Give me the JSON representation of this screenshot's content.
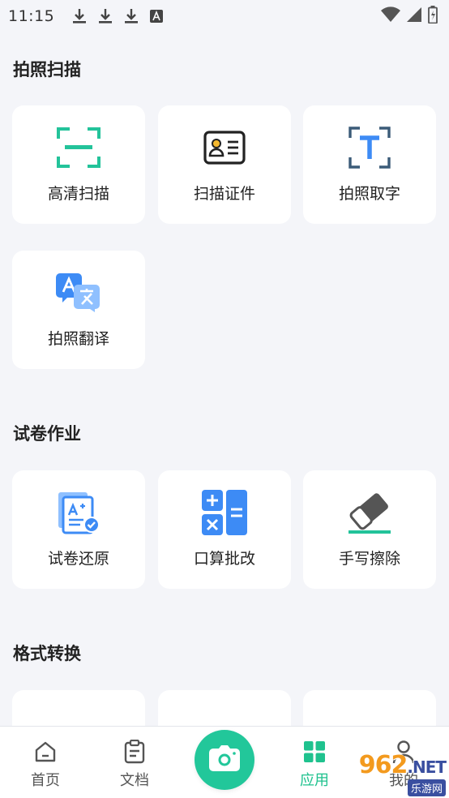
{
  "status_bar": {
    "time": "11:15"
  },
  "sections": [
    {
      "title": "拍照扫描",
      "cards": [
        {
          "label": "高清扫描",
          "icon": "scan-frame-icon"
        },
        {
          "label": "扫描证件",
          "icon": "id-card-icon"
        },
        {
          "label": "拍照取字",
          "icon": "text-extract-icon"
        },
        {
          "label": "拍照翻译",
          "icon": "translate-icon"
        }
      ]
    },
    {
      "title": "试卷作业",
      "cards": [
        {
          "label": "试卷还原",
          "icon": "paper-restore-icon"
        },
        {
          "label": "口算批改",
          "icon": "calculator-icon"
        },
        {
          "label": "手写擦除",
          "icon": "eraser-icon"
        }
      ]
    },
    {
      "title": "格式转换",
      "cards": [
        {
          "label": "",
          "icon": "word-convert-icon"
        },
        {
          "label": "",
          "icon": "excel-convert-icon"
        },
        {
          "label": "",
          "icon": "ppt-convert-icon"
        }
      ]
    }
  ],
  "bottom_nav": {
    "items": [
      {
        "label": "首页",
        "icon": "home-icon"
      },
      {
        "label": "文档",
        "icon": "clipboard-icon"
      },
      {
        "label": "应用",
        "icon": "apps-grid-icon"
      },
      {
        "label": "我的",
        "icon": "user-icon"
      }
    ],
    "active": "应用",
    "camera_icon": "camera-icon"
  },
  "watermark": {
    "main": "962",
    "suffix": ".NET",
    "sub": "乐游网"
  },
  "colors": {
    "accent": "#1fc28e",
    "camera": "#22c79a",
    "blue": "#3d8bf5",
    "background": "#f4f5f9"
  }
}
